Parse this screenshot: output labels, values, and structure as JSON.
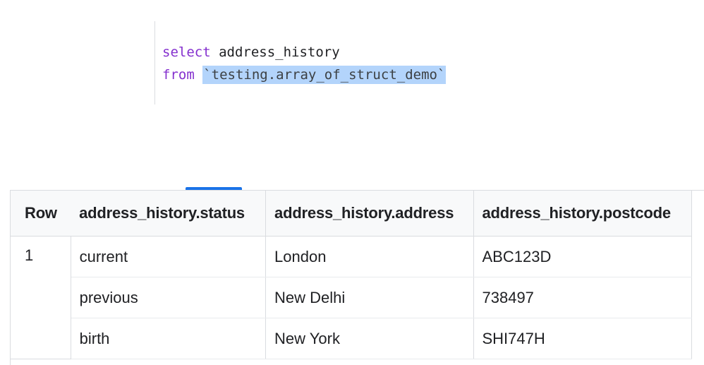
{
  "editor": {
    "line1": {
      "keyword": "select",
      "text": " address_history"
    },
    "line2": {
      "keyword": "from",
      "space": " ",
      "selected": "`testing.array_of_struct_demo`"
    }
  },
  "results": {
    "columns": [
      "Row",
      "address_history.status",
      "address_history.address",
      "address_history.postcode"
    ],
    "row_number": "1",
    "entries": [
      {
        "status": "current",
        "address": "London",
        "postcode": "ABC123D"
      },
      {
        "status": "previous",
        "address": "New Delhi",
        "postcode": "738497"
      },
      {
        "status": "birth",
        "address": "New York",
        "postcode": "SHI747H"
      }
    ]
  },
  "colors": {
    "keyword": "#8430ce",
    "selection": "#b3d4fb",
    "tab_accent": "#1a73e8",
    "grid_border": "#dadce0"
  }
}
